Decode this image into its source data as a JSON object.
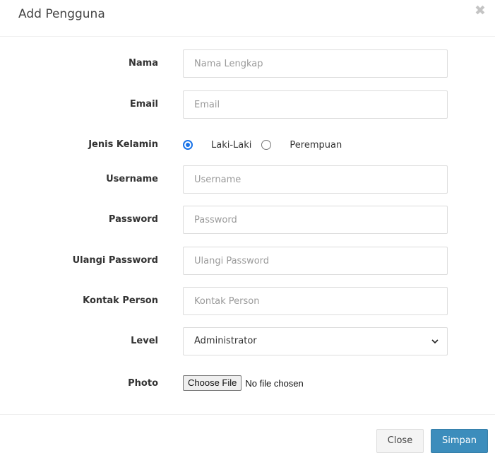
{
  "modal": {
    "title": "Add Pengguna",
    "close_icon": "close-x-icon"
  },
  "form": {
    "nama": {
      "label": "Nama",
      "value": "",
      "placeholder": "Nama Lengkap"
    },
    "email": {
      "label": "Email",
      "value": "",
      "placeholder": "Email"
    },
    "jenis_kelamin": {
      "label": "Jenis Kelamin",
      "options": [
        {
          "label": "Laki-Laki",
          "checked": true
        },
        {
          "label": "Perempuan",
          "checked": false
        }
      ]
    },
    "username": {
      "label": "Username",
      "value": "",
      "placeholder": "Username"
    },
    "password": {
      "label": "Password",
      "value": "",
      "placeholder": "Password"
    },
    "ulangi_password": {
      "label": "Ulangi Password",
      "value": "",
      "placeholder": "Ulangi Password"
    },
    "kontak_person": {
      "label": "Kontak Person",
      "value": "",
      "placeholder": "Kontak Person"
    },
    "level": {
      "label": "Level",
      "selected": "Administrator"
    },
    "photo": {
      "label": "Photo",
      "button_label": "Choose File",
      "status": "No file chosen"
    }
  },
  "footer": {
    "close_label": "Close",
    "save_label": "Simpan"
  },
  "colors": {
    "primary": "#3c8dbc",
    "radio_accent": "#1a73e8"
  }
}
